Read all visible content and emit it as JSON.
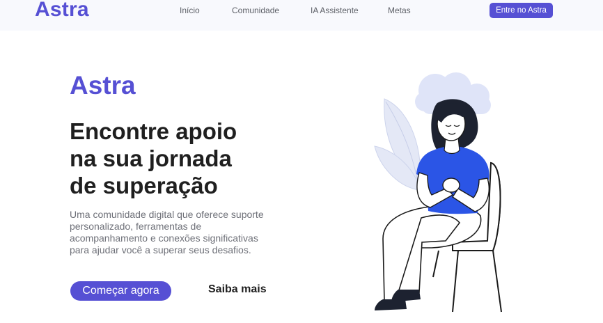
{
  "header": {
    "brand": "Astra",
    "nav": [
      "Início",
      "Comunidade",
      "IA Assistente",
      "Metas"
    ],
    "cta": "Entre no Astra"
  },
  "hero": {
    "brand": "Astra",
    "title_lines": [
      "Encontre apoio",
      "na sua jornada",
      "de superação"
    ],
    "description": "Uma comunidade digital que oferece suporte personalizado, ferramentas de acompanhamento e conexões significativas para ajudar você a superar seus desafios.",
    "primary_button": "Começar agora",
    "secondary_button": "Saiba mais"
  },
  "colors": {
    "brand": "#5650d4",
    "navbar_bg": "#f8f9fd",
    "shirt": "#2b55e6",
    "cloud": "#dfe4f8"
  },
  "icons": {
    "illustration": "woman-sitting-on-chair-illustration"
  }
}
